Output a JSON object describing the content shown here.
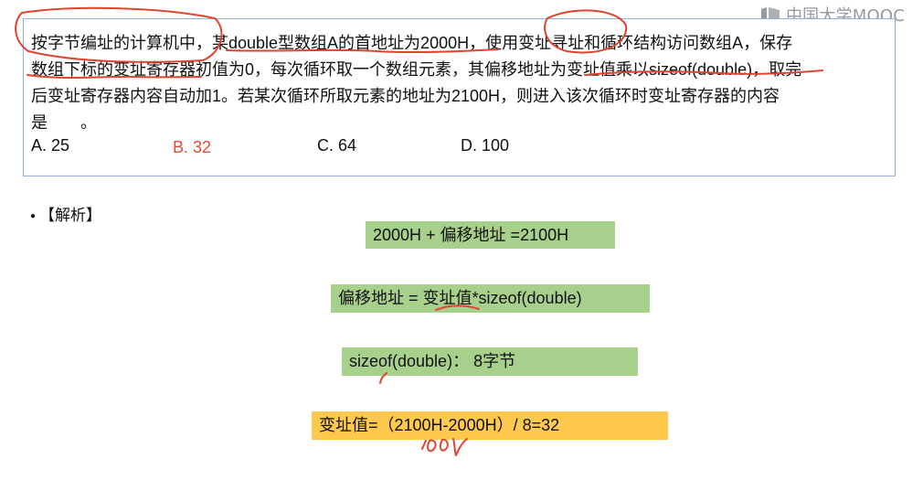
{
  "watermark": {
    "logo_text": "中国大学MOOC"
  },
  "question": {
    "lines": [
      "按字节编址的计算机中，某double型数组A的首地址为2000H，使用变址寻址和循环结构访问数组A，保存",
      "数组下标的变址寄存器初值为0，每次循环取一个数组元素，其偏移地址为变址值乘以sizeof(double)，取完",
      "后变址寄存器内容自动加1。若某次循环所取元素的地址为2100H，则进入该次循环时变址寄存器的内容",
      "是　　。"
    ],
    "options": [
      {
        "id": "A",
        "label": "A. 25",
        "correct": false
      },
      {
        "id": "B",
        "label": "B. 32",
        "correct": true
      },
      {
        "id": "C",
        "label": "C. 64",
        "correct": false
      },
      {
        "id": "D",
        "label": "D. 100",
        "correct": false
      }
    ]
  },
  "analysis": {
    "title": "【解析】",
    "formulas": [
      "2000H + 偏移地址 =2100H",
      "偏移地址 = 变址值*sizeof(double)",
      "sizeof(double)： 8字节",
      "变址值=（2100H-2000H）/ 8=32"
    ]
  },
  "colors": {
    "card_border": "#8fb1d8",
    "correct_answer": "#e24a33",
    "formula_green": "#a8d08d",
    "formula_yellow": "#ffc94d",
    "annotation_red": "#e0442f",
    "watermark_gray": "#8a8f96"
  },
  "icons": {
    "watermark": "mooc-logo-icon",
    "bullet": "bullet-icon"
  }
}
